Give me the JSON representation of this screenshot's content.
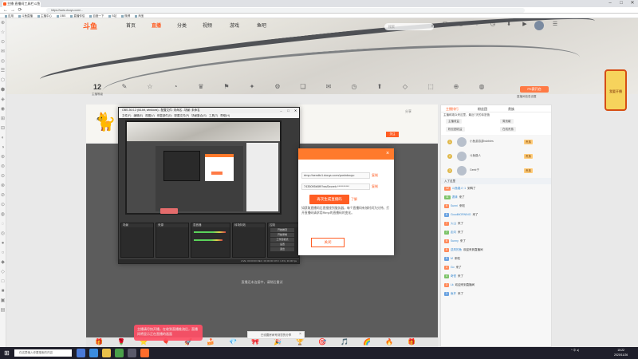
{
  "browser": {
    "tab_title": "主播·直播间工具栏斗鱼",
    "url": "https://www.douyu.com/...",
    "bookmarks": [
      "应用",
      "斗鱼直播",
      "主播中心",
      "OBS",
      "直播伴侣",
      "百度一下",
      "B站",
      "微博",
      "淘宝"
    ],
    "window_controls": [
      "–",
      "□",
      "✕"
    ],
    "nav": [
      "←",
      "→",
      "⟳"
    ]
  },
  "leftbar": {
    "icons": [
      "⊕",
      "☆",
      "⊙",
      "✉",
      "◎",
      "☰",
      "⬡",
      "⬢",
      "◈",
      "◉",
      "⊞",
      "⊟",
      "◐",
      "◑",
      "⊛",
      "⊜",
      "⊝",
      "⊗",
      "⊘",
      "⊙",
      "◍",
      "◌",
      "◎",
      "●",
      "○",
      "◆",
      "◇",
      "□",
      "■",
      "▣",
      "▤",
      "▥",
      "▦"
    ]
  },
  "topnav": {
    "logo": "斗鱼",
    "items": [
      "首页",
      "直播",
      "分类",
      "视频",
      "游戏",
      "鱼吧"
    ],
    "search_placeholder": "搜索",
    "icons": [
      {
        "glyph": "✉",
        "label": ""
      },
      {
        "glyph": "◎",
        "label": ""
      },
      {
        "glyph": "♡",
        "label": ""
      },
      {
        "glyph": "◷",
        "label": ""
      },
      {
        "glyph": "⬇",
        "label": ""
      },
      {
        "glyph": "▶",
        "label": ""
      },
      {
        "glyph": "☰",
        "label": ""
      }
    ],
    "open_live_label": "我要开播"
  },
  "toolbar": {
    "level": "12",
    "level_label": "主播等级",
    "icons": [
      {
        "glyph": "✎",
        "label": ""
      },
      {
        "glyph": "☆",
        "label": ""
      },
      {
        "glyph": "◔",
        "label": ""
      },
      {
        "glyph": "♛",
        "label": ""
      },
      {
        "glyph": "⚑",
        "label": ""
      },
      {
        "glyph": "✦",
        "label": ""
      },
      {
        "glyph": "⚙",
        "label": ""
      },
      {
        "glyph": "❏",
        "label": ""
      },
      {
        "glyph": "✉",
        "label": ""
      },
      {
        "glyph": "◷",
        "label": ""
      },
      {
        "glyph": "⬆",
        "label": ""
      },
      {
        "glyph": "◇",
        "label": ""
      },
      {
        "glyph": "⬚",
        "label": ""
      },
      {
        "glyph": "⊕",
        "label": ""
      },
      {
        "glyph": "◍",
        "label": ""
      }
    ],
    "pk_label": "PK赛开启",
    "pk_sub": "直播间信息设置"
  },
  "room": {
    "follow_label": "关注",
    "share_label": "分享"
  },
  "player": {
    "hint": "直播还未连接中，请稍后重试"
  },
  "gifts": [
    "🎁",
    "🌹",
    "⭐",
    "🎈",
    "🚀",
    "🍰",
    "💎",
    "🎀",
    "🎉",
    "🏆",
    "🎯",
    "🎵",
    "🌈",
    "🔥",
    "🎁"
  ],
  "toast": "主播请尽快开播，在收到直播推流后，直播间将显示正在直播的画面",
  "bottom_tip": "已设置房间号到您的分享",
  "obs": {
    "title": "OBS 26.0.2 (64-bit, windows) - 配置文件: 未命名 - 场景: 未命名",
    "menu": "文件(F) 编辑(E) 视图(V) 停靠部件(D) 配置文件(P) 场景集合(S) 工具(T) 帮助(H)",
    "docks": [
      "场景",
      "来源",
      "混音器",
      "转场特效",
      "控制"
    ],
    "controls": [
      "开始推流",
      "开始录制",
      "工作室模式",
      "设置",
      "退出"
    ],
    "status": "LIVE: 00:00:00  REC: 00:00:00  CPU: 1.6%, 30.00 fps"
  },
  "dialog": {
    "server_label": "",
    "server_value": "rtmp://sendtc1.douyu.com/pushdouyu",
    "key_value": "7435095b5f9?wsSecret=**********",
    "copy_label": "复制",
    "reset_label": "再次生成直播码",
    "link": "了解",
    "note": "如获取直播码后直接接到服务器，每个直播码有效时间为分钟。打开直播码请求用Rtmp的直播码的变化。",
    "ok_label": "关闭"
  },
  "chat": {
    "tabs": [
      "主播排行",
      "粉丝团",
      "贵族"
    ],
    "subtitle": "主播和观众来这里，最近7天的亲密值",
    "pills": [
      "主播收益",
      "周贡献",
      "粉丝团收益",
      "在线贵族"
    ],
    "ranks": [
      {
        "medal": "1",
        "name": "小鱼游游游bubbles",
        "badge": "贵族"
      },
      {
        "medal": "2",
        "name": "斗鱼路人",
        "badge": "贵族"
      },
      {
        "medal": "3",
        "name": "Geek子",
        "badge": "贵族"
      }
    ],
    "section": "入了这里",
    "messages": [
      {
        "tag": "12",
        "tc": "",
        "nick": "斗鱼路人·1",
        "text": "到鸭了"
      },
      {
        "tag": "11",
        "tc": "g",
        "nick": "潇清",
        "text": "来了"
      },
      {
        "tag": "9",
        "tc": "",
        "nick": "Sunni",
        "text": "来啦"
      },
      {
        "tag": "8",
        "tc": "b",
        "nick": "GoodMORNING",
        "text": "来了"
      },
      {
        "tag": "7",
        "tc": "",
        "nick": "火山",
        "text": "来了"
      },
      {
        "tag": "7",
        "tc": "g",
        "nick": "走向",
        "text": "来了"
      },
      {
        "tag": "6",
        "tc": "",
        "nick": "Sunny",
        "text": "来了"
      },
      {
        "tag": "5",
        "tc": "",
        "nick": "逆风的鱼",
        "text": "欢迎来到直播间"
      },
      {
        "tag": "5",
        "tc": "b",
        "nick": "M",
        "text": "来啦"
      },
      {
        "tag": "4",
        "tc": "",
        "nick": "Go",
        "text": "来了"
      },
      {
        "tag": "4",
        "tc": "g",
        "nick": "奇怪",
        "text": "来了"
      },
      {
        "tag": "3",
        "tc": "",
        "nick": "Lk",
        "text": "欢迎来到直播间"
      },
      {
        "tag": "3",
        "tc": "b",
        "nick": "鱼杆",
        "text": "来了"
      }
    ]
  },
  "taskbar": {
    "search_placeholder": "在这里输入你要搜索的内容",
    "tray": "^ 中 ◂)",
    "time": "15:22",
    "date": "2020/11/26"
  }
}
